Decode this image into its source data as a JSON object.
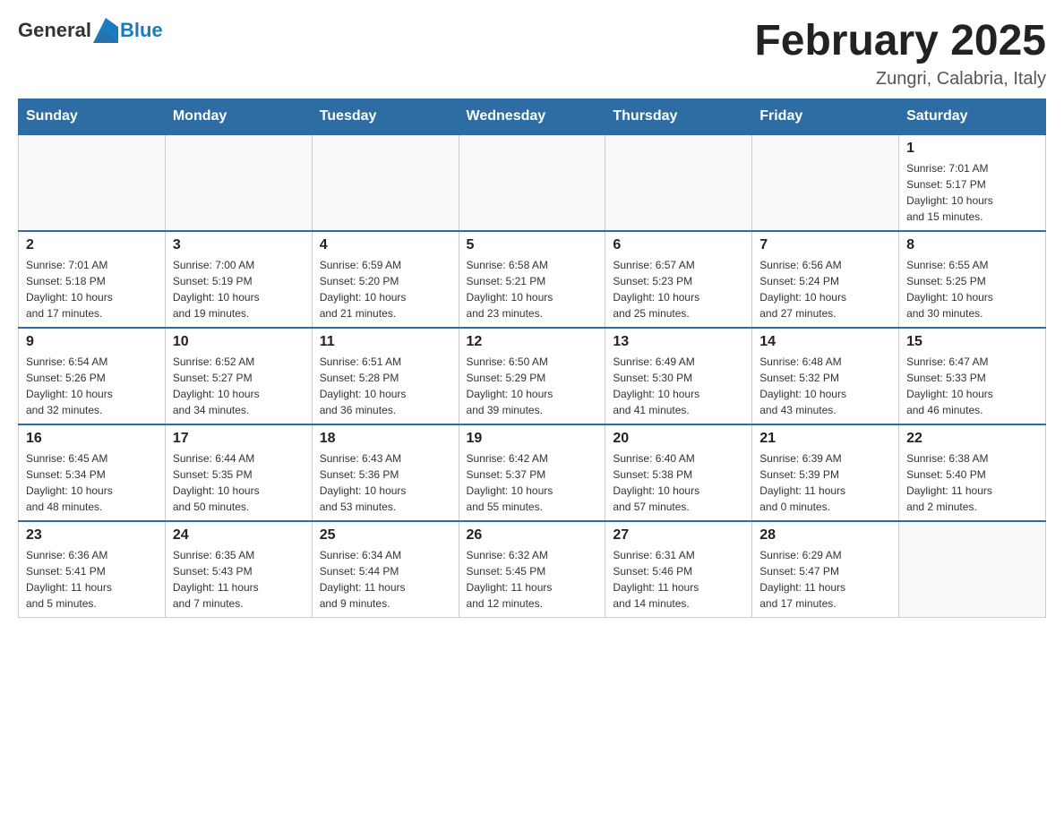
{
  "header": {
    "logo_general": "General",
    "logo_blue": "Blue",
    "month_title": "February 2025",
    "location": "Zungri, Calabria, Italy"
  },
  "weekdays": [
    "Sunday",
    "Monday",
    "Tuesday",
    "Wednesday",
    "Thursday",
    "Friday",
    "Saturday"
  ],
  "weeks": [
    [
      {
        "day": "",
        "info": ""
      },
      {
        "day": "",
        "info": ""
      },
      {
        "day": "",
        "info": ""
      },
      {
        "day": "",
        "info": ""
      },
      {
        "day": "",
        "info": ""
      },
      {
        "day": "",
        "info": ""
      },
      {
        "day": "1",
        "info": "Sunrise: 7:01 AM\nSunset: 5:17 PM\nDaylight: 10 hours\nand 15 minutes."
      }
    ],
    [
      {
        "day": "2",
        "info": "Sunrise: 7:01 AM\nSunset: 5:18 PM\nDaylight: 10 hours\nand 17 minutes."
      },
      {
        "day": "3",
        "info": "Sunrise: 7:00 AM\nSunset: 5:19 PM\nDaylight: 10 hours\nand 19 minutes."
      },
      {
        "day": "4",
        "info": "Sunrise: 6:59 AM\nSunset: 5:20 PM\nDaylight: 10 hours\nand 21 minutes."
      },
      {
        "day": "5",
        "info": "Sunrise: 6:58 AM\nSunset: 5:21 PM\nDaylight: 10 hours\nand 23 minutes."
      },
      {
        "day": "6",
        "info": "Sunrise: 6:57 AM\nSunset: 5:23 PM\nDaylight: 10 hours\nand 25 minutes."
      },
      {
        "day": "7",
        "info": "Sunrise: 6:56 AM\nSunset: 5:24 PM\nDaylight: 10 hours\nand 27 minutes."
      },
      {
        "day": "8",
        "info": "Sunrise: 6:55 AM\nSunset: 5:25 PM\nDaylight: 10 hours\nand 30 minutes."
      }
    ],
    [
      {
        "day": "9",
        "info": "Sunrise: 6:54 AM\nSunset: 5:26 PM\nDaylight: 10 hours\nand 32 minutes."
      },
      {
        "day": "10",
        "info": "Sunrise: 6:52 AM\nSunset: 5:27 PM\nDaylight: 10 hours\nand 34 minutes."
      },
      {
        "day": "11",
        "info": "Sunrise: 6:51 AM\nSunset: 5:28 PM\nDaylight: 10 hours\nand 36 minutes."
      },
      {
        "day": "12",
        "info": "Sunrise: 6:50 AM\nSunset: 5:29 PM\nDaylight: 10 hours\nand 39 minutes."
      },
      {
        "day": "13",
        "info": "Sunrise: 6:49 AM\nSunset: 5:30 PM\nDaylight: 10 hours\nand 41 minutes."
      },
      {
        "day": "14",
        "info": "Sunrise: 6:48 AM\nSunset: 5:32 PM\nDaylight: 10 hours\nand 43 minutes."
      },
      {
        "day": "15",
        "info": "Sunrise: 6:47 AM\nSunset: 5:33 PM\nDaylight: 10 hours\nand 46 minutes."
      }
    ],
    [
      {
        "day": "16",
        "info": "Sunrise: 6:45 AM\nSunset: 5:34 PM\nDaylight: 10 hours\nand 48 minutes."
      },
      {
        "day": "17",
        "info": "Sunrise: 6:44 AM\nSunset: 5:35 PM\nDaylight: 10 hours\nand 50 minutes."
      },
      {
        "day": "18",
        "info": "Sunrise: 6:43 AM\nSunset: 5:36 PM\nDaylight: 10 hours\nand 53 minutes."
      },
      {
        "day": "19",
        "info": "Sunrise: 6:42 AM\nSunset: 5:37 PM\nDaylight: 10 hours\nand 55 minutes."
      },
      {
        "day": "20",
        "info": "Sunrise: 6:40 AM\nSunset: 5:38 PM\nDaylight: 10 hours\nand 57 minutes."
      },
      {
        "day": "21",
        "info": "Sunrise: 6:39 AM\nSunset: 5:39 PM\nDaylight: 11 hours\nand 0 minutes."
      },
      {
        "day": "22",
        "info": "Sunrise: 6:38 AM\nSunset: 5:40 PM\nDaylight: 11 hours\nand 2 minutes."
      }
    ],
    [
      {
        "day": "23",
        "info": "Sunrise: 6:36 AM\nSunset: 5:41 PM\nDaylight: 11 hours\nand 5 minutes."
      },
      {
        "day": "24",
        "info": "Sunrise: 6:35 AM\nSunset: 5:43 PM\nDaylight: 11 hours\nand 7 minutes."
      },
      {
        "day": "25",
        "info": "Sunrise: 6:34 AM\nSunset: 5:44 PM\nDaylight: 11 hours\nand 9 minutes."
      },
      {
        "day": "26",
        "info": "Sunrise: 6:32 AM\nSunset: 5:45 PM\nDaylight: 11 hours\nand 12 minutes."
      },
      {
        "day": "27",
        "info": "Sunrise: 6:31 AM\nSunset: 5:46 PM\nDaylight: 11 hours\nand 14 minutes."
      },
      {
        "day": "28",
        "info": "Sunrise: 6:29 AM\nSunset: 5:47 PM\nDaylight: 11 hours\nand 17 minutes."
      },
      {
        "day": "",
        "info": ""
      }
    ]
  ]
}
